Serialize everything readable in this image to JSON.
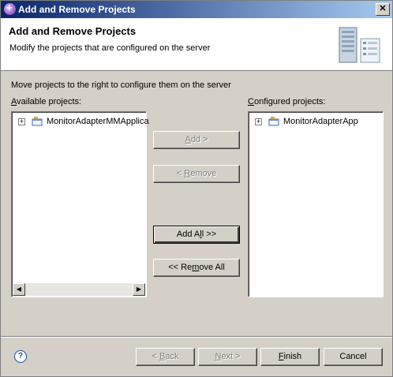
{
  "window": {
    "title": "Add and Remove Projects",
    "close_glyph": "✕"
  },
  "header": {
    "title": "Add and Remove Projects",
    "description": "Modify the projects that are configured on the server"
  },
  "instruction": "Move projects to the right to configure them on the server",
  "available": {
    "label_prefix": "",
    "label_mnemonic": "A",
    "label_rest": "vailable projects:",
    "items": [
      "MonitorAdapterMMApplica"
    ]
  },
  "configured": {
    "label_prefix": "",
    "label_mnemonic": "C",
    "label_rest": "onfigured projects:",
    "items": [
      "MonitorAdapterApp"
    ]
  },
  "buttons": {
    "add": {
      "prefix": "",
      "mnemonic": "A",
      "rest": "dd >"
    },
    "remove": {
      "prefix": "< ",
      "mnemonic": "R",
      "rest": "emove"
    },
    "add_all": {
      "prefix": "Add A",
      "mnemonic": "l",
      "rest": "l >>"
    },
    "remove_all": {
      "prefix": "<< Re",
      "mnemonic": "m",
      "rest": "ove All"
    },
    "back": {
      "prefix": "< ",
      "mnemonic": "B",
      "rest": "ack"
    },
    "next": {
      "prefix": "",
      "mnemonic": "N",
      "rest": "ext >"
    },
    "finish": {
      "prefix": "",
      "mnemonic": "F",
      "rest": "inish"
    },
    "cancel": "Cancel"
  },
  "icons": {
    "expander": "+",
    "scroll_left": "◀",
    "scroll_right": "▶",
    "help": "?"
  }
}
